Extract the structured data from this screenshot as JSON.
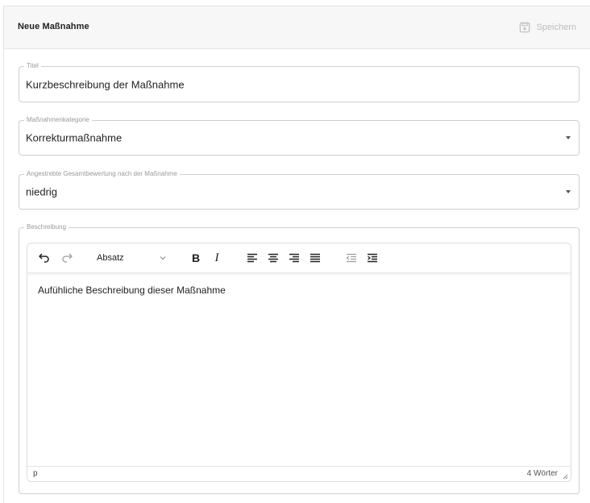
{
  "header": {
    "title": "Neue Maßnahme",
    "save_label": "Speichern",
    "save_icon": "floppy-disk-icon"
  },
  "fields": {
    "titel": {
      "label": "Titel",
      "value": "Kurzbeschreibung der Maßnahme"
    },
    "kategorie": {
      "label": "Maßnahmenkategorie",
      "value": "Korrekturmaßnahme"
    },
    "bewertung": {
      "label": "Angestrebte Gesamtbewertung nach der Maßnahme",
      "value": "niedrig"
    },
    "beschreibung": {
      "label": "Beschreibung"
    }
  },
  "editor": {
    "toolbar": {
      "block_format": "Absatz",
      "bold_label": "B",
      "italic_label": "I",
      "icons": [
        "undo-icon",
        "redo-icon",
        "align-left-icon",
        "align-center-icon",
        "align-right-icon",
        "align-justify-icon",
        "outdent-icon",
        "indent-icon"
      ]
    },
    "content": "Aufühliche Beschreibung dieser Maßnahme",
    "status_path": "p",
    "word_count": "4 Wörter"
  },
  "colors": {
    "header_bg": "#f7f7f7",
    "border": "#cfcfcf",
    "disabled_text": "#bdbdbd",
    "label_text": "#9a9a9a"
  }
}
